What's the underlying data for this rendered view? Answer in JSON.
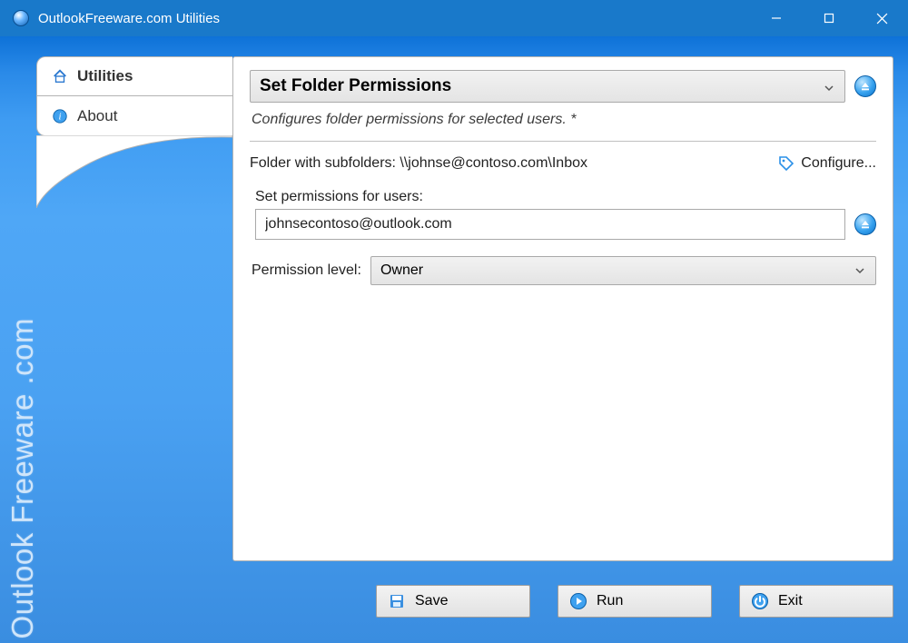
{
  "window": {
    "title": "OutlookFreeware.com Utilities"
  },
  "sidebar": {
    "tabs": [
      {
        "label": "Utilities"
      },
      {
        "label": "About"
      }
    ],
    "watermark": "Outlook Freeware .com"
  },
  "main": {
    "header": "Set Folder Permissions",
    "description": "Configures folder permissions for selected users. *",
    "folder_label": "Folder with subfolders: \\\\johnse@contoso.com\\Inbox",
    "configure_label": "Configure...",
    "users_label": "Set permissions for users:",
    "users_value": "johnsecontoso@outlook.com",
    "perm_label": "Permission level:",
    "perm_value": "Owner"
  },
  "buttons": {
    "save": "Save",
    "run": "Run",
    "exit": "Exit"
  }
}
